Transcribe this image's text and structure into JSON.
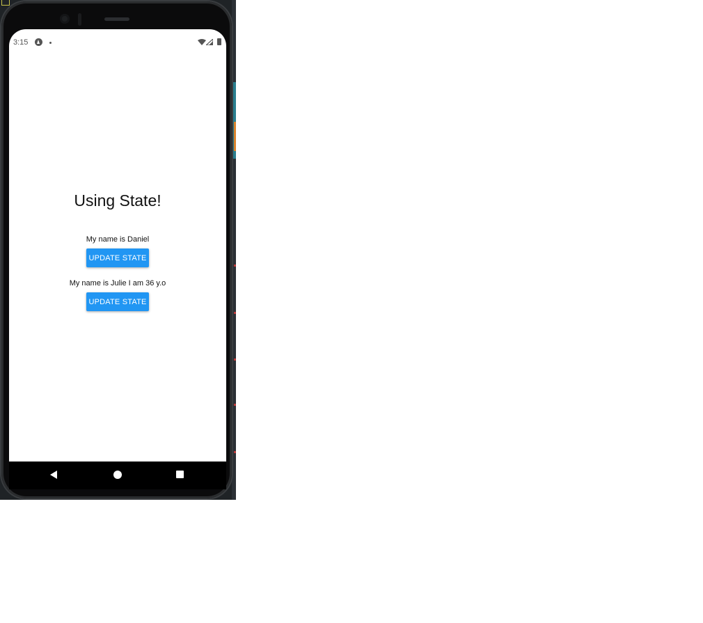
{
  "status_bar": {
    "time": "3:15"
  },
  "app": {
    "title": "Using State!",
    "person1": {
      "text": "My name is Daniel",
      "button_label": "UPDATE STATE"
    },
    "person2": {
      "text": "My name is Julie I am 36 y.o",
      "button_label": "UPDATE STATE"
    }
  },
  "colors": {
    "button_bg": "#2196f3",
    "screen_bg": "#ffffff",
    "navbar_bg": "#000000"
  },
  "icons": {
    "status": [
      "app-notification-icon",
      "wifi-icon",
      "cell-signal-icon",
      "battery-icon"
    ],
    "navigation": [
      "back-icon",
      "home-icon",
      "recents-icon"
    ]
  }
}
